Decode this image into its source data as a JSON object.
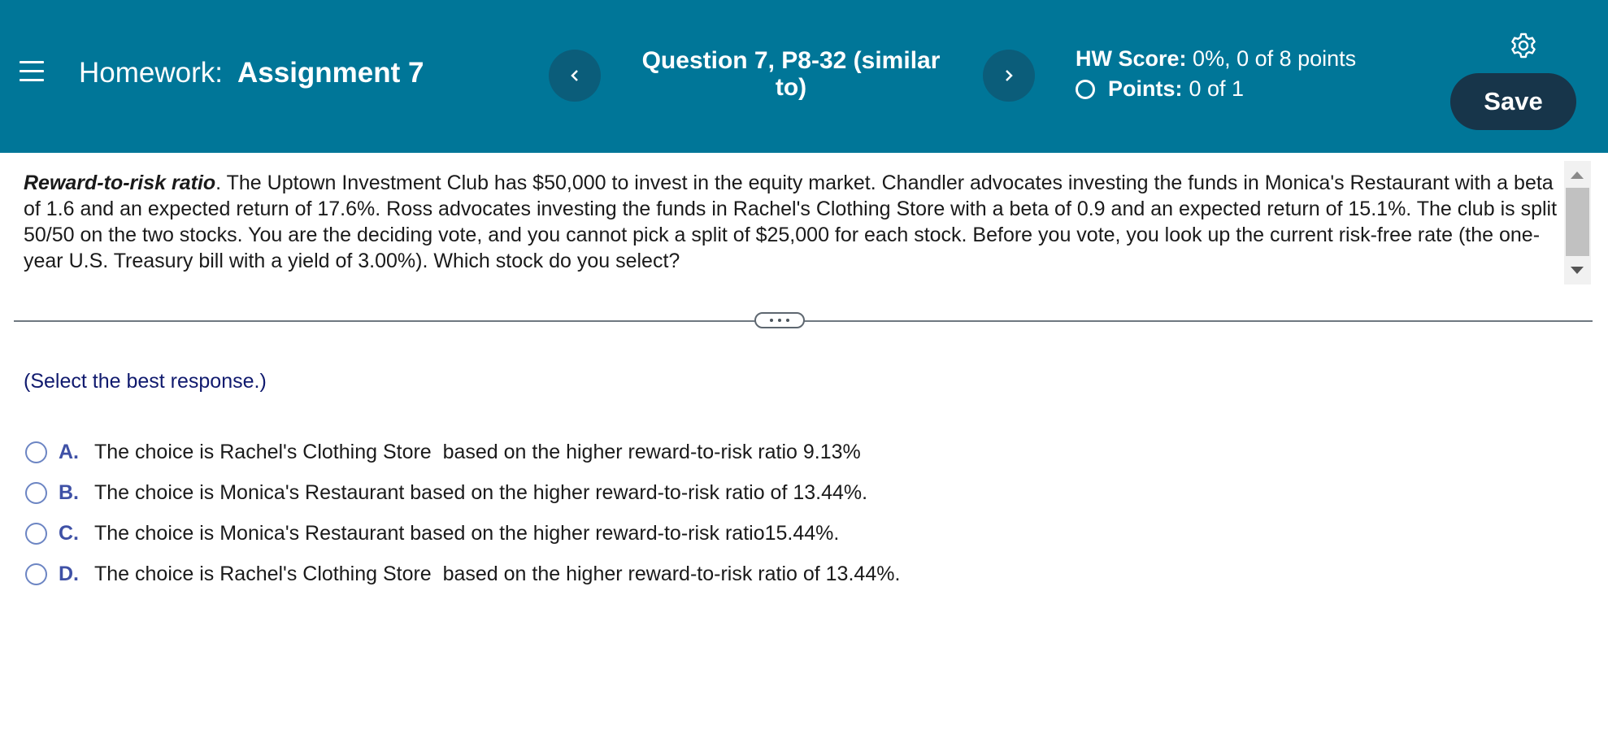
{
  "header": {
    "homework_prefix": "Homework:",
    "assignment_name": "Assignment 7",
    "question_title": "Question 7, P8-32 (similar to)",
    "hw_score_label": "HW Score:",
    "hw_score_value": "0%, 0 of 8 points",
    "points_label": "Points:",
    "points_value": "0 of 1",
    "save_label": "Save",
    "background_color": "#007698",
    "save_button_color": "#17354a"
  },
  "icons": {
    "menu": "hamburger-menu-icon",
    "prev": "chevron-left-icon",
    "next": "chevron-right-icon",
    "settings": "gear-icon",
    "status": "circle-outline-icon"
  },
  "problem": {
    "lead": "Reward-to-risk ratio",
    "text": ".  The Uptown Investment Club has $50,000 to invest in the equity market.  Chandler advocates investing the funds in Monica's Restaurant with a beta of 1.6 and an expected return of 17.6%.  Ross advocates investing the funds in Rachel's Clothing Store with a beta of 0.9 and an expected return of 15.1%.  The club is split 50/50 on the two stocks.  You are the deciding vote, and you cannot pick a split of $25,000 for each stock.  Before you vote, you look up the current risk-free rate (the one-year U.S. Treasury bill with a yield of 3.00%).  Which stock do you select?"
  },
  "instruction": "(Select the best response.)",
  "options": [
    {
      "letter": "A.",
      "text": "The choice is Rachel's Clothing Store  based on the higher reward-to-risk ratio 9.13%"
    },
    {
      "letter": "B.",
      "text": "The choice is Monica's Restaurant based on the higher reward-to-risk ratio of 13.44%."
    },
    {
      "letter": "C.",
      "text": "The choice is Monica's Restaurant based on the higher reward-to-risk ratio15.44%."
    },
    {
      "letter": "D.",
      "text": "The choice is Rachel's Clothing Store  based on the higher reward-to-risk ratio of 13.44%."
    }
  ]
}
